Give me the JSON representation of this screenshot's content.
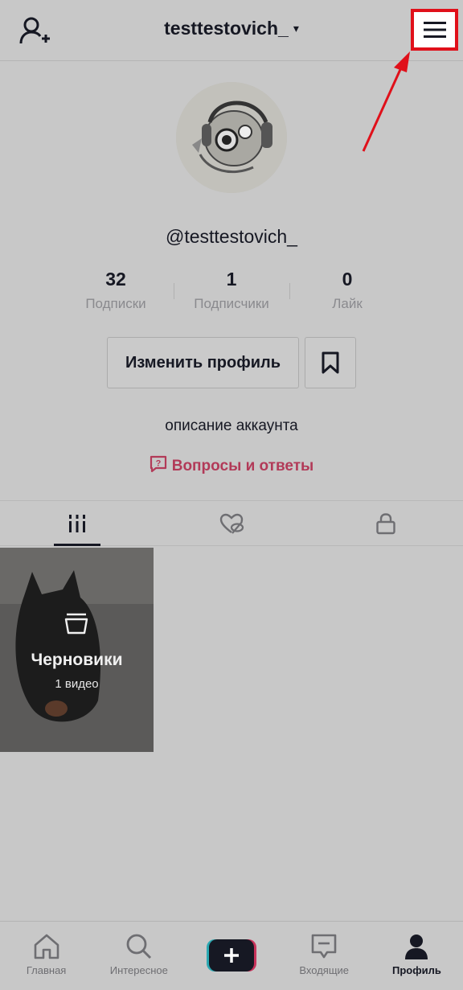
{
  "header": {
    "username": "testtestovich_",
    "caret": "▾"
  },
  "profile": {
    "handle": "@testtestovich_",
    "stats": [
      {
        "value": "32",
        "label": "Подписки"
      },
      {
        "value": "1",
        "label": "Подписчики"
      },
      {
        "value": "0",
        "label": "Лайк"
      }
    ],
    "edit_label": "Изменить профиль",
    "bio": "описание аккаунта",
    "qa_label": "Вопросы и ответы"
  },
  "tabs": [
    {
      "icon": "grid-icon",
      "active": true
    },
    {
      "icon": "hidden-likes-icon",
      "active": false
    },
    {
      "icon": "lock-icon",
      "active": false
    }
  ],
  "drafts": {
    "title": "Черновики",
    "count": "1 видео"
  },
  "bottom_nav": [
    {
      "label": "Главная",
      "icon": "home-icon"
    },
    {
      "label": "Интересное",
      "icon": "search-icon"
    },
    {
      "label": "",
      "icon": "plus-icon"
    },
    {
      "label": "Входящие",
      "icon": "inbox-icon"
    },
    {
      "label": "Профиль",
      "icon": "profile-icon",
      "active": true
    }
  ],
  "colors": {
    "overlay_bg": "#c8c8c8",
    "highlight": "#e0101a",
    "qa_accent": "#b23a58"
  }
}
